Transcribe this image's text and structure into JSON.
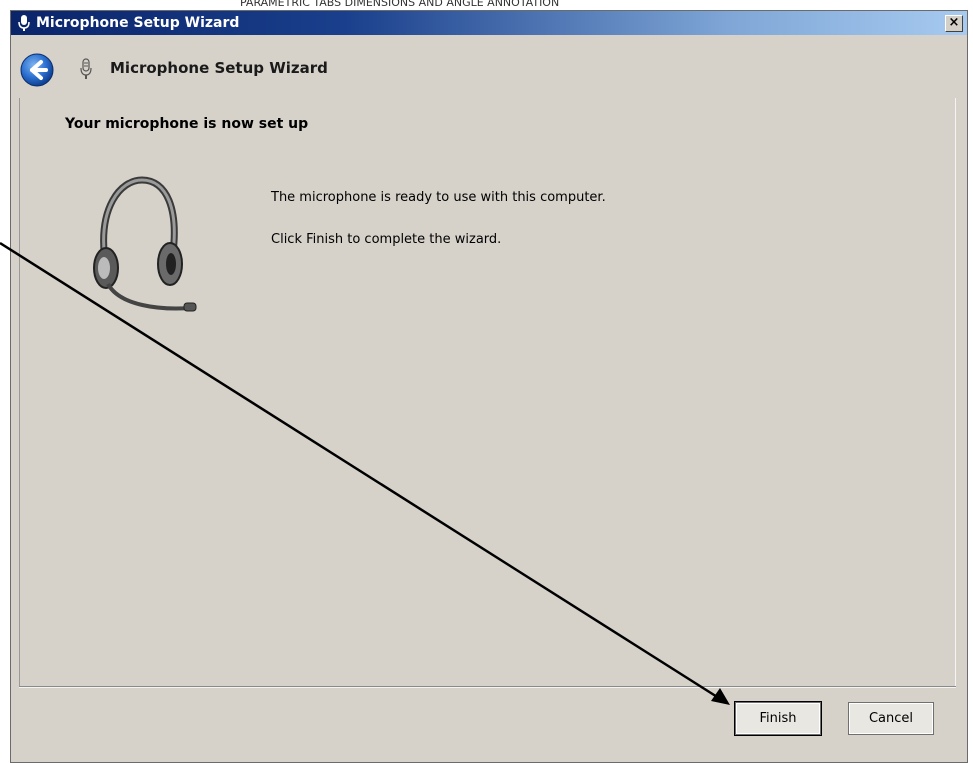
{
  "window": {
    "title": "Microphone Setup Wizard",
    "close_label": "×"
  },
  "background": {
    "cut_text": "PARAMETRIC TABS DIMENSIONS AND ANGLE ANNOTATION"
  },
  "header": {
    "title": "Microphone Setup Wizard"
  },
  "content": {
    "heading": "Your microphone is now set up",
    "message_line_1": "The microphone is ready to use with this computer.",
    "message_line_2": "Click Finish to complete the wizard."
  },
  "buttons": {
    "finish_label": "Finish",
    "cancel_label": "Cancel"
  },
  "colors": {
    "titlebar_start": "#0a246a",
    "titlebar_end": "#a6caf0",
    "window_bg": "#d6d2ca",
    "back_button": "#2a6fd0"
  },
  "icons": [
    "microphone-icon",
    "back-arrow-icon",
    "headset-icon",
    "close-icon"
  ]
}
